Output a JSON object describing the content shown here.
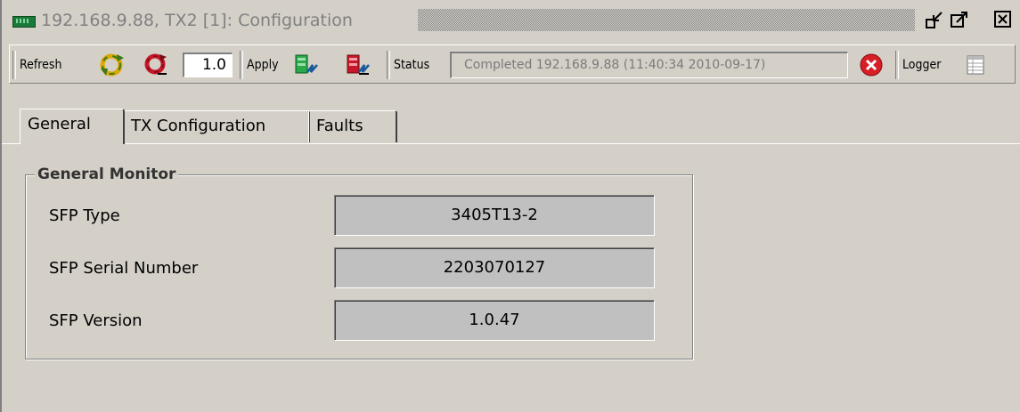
{
  "window": {
    "title": "192.168.9.88, TX2  [1]: Configuration"
  },
  "toolbar": {
    "refresh_label": "Refresh",
    "version_value": "1.0",
    "apply_label": "Apply",
    "status_label": "Status",
    "status_text": "Completed 192.168.9.88 (11:40:34  2010-09-17)",
    "logger_label": "Logger"
  },
  "tabs": [
    {
      "label": "General",
      "active": true
    },
    {
      "label": "TX Configuration",
      "active": false
    },
    {
      "label": "Faults",
      "active": false
    }
  ],
  "general_monitor": {
    "title": "General Monitor",
    "rows": [
      {
        "label": "SFP Type",
        "value": "3405T13-2"
      },
      {
        "label": "SFP Serial Number",
        "value": "2203070127"
      },
      {
        "label": "SFP Version",
        "value": "1.0.47"
      }
    ]
  },
  "colors": {
    "background": "#d4d0c8",
    "title_text": "#808080",
    "error_icon": "#d61f26"
  }
}
